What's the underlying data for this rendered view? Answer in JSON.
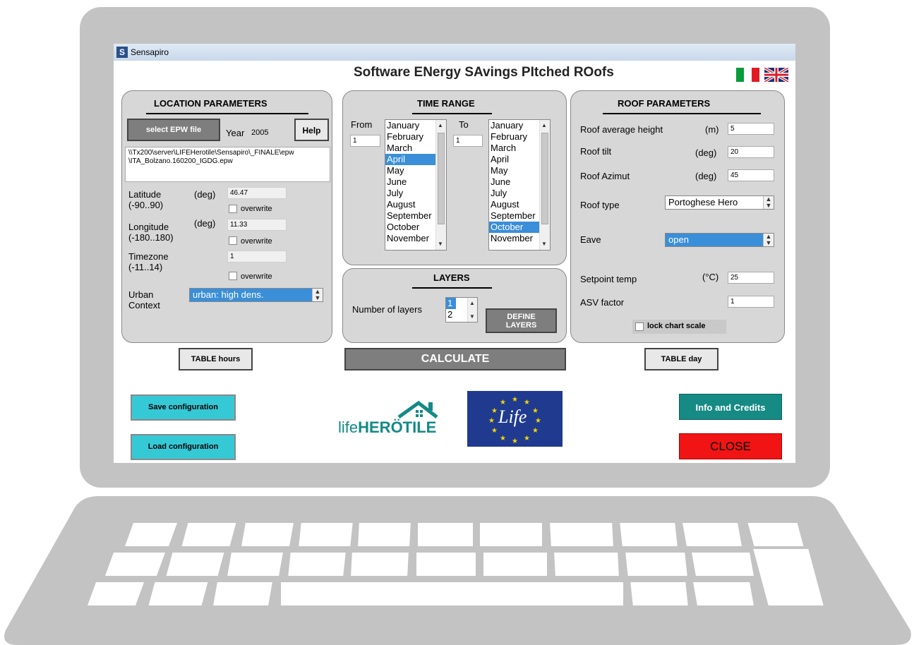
{
  "window": {
    "title": "Sensapiro",
    "icon_letter": "S"
  },
  "app_title": "Software ENergy SAvings PItched ROofs",
  "languages": [
    "italian-flag",
    "uk-flag"
  ],
  "location": {
    "title": "LOCATION PARAMETERS",
    "select_epw_label": "select EPW file",
    "year_label": "Year",
    "year_value": "2005",
    "help_label": "Help",
    "epw_path_line1": "\\\\Tx200\\server\\LIFEHerotile\\Sensapiro\\_FINALE\\epw",
    "epw_path_line2": "\\ITA_Bolzano.160200_IGDG.epw",
    "latitude_label": "Latitude",
    "latitude_range": "(-90..90)",
    "latitude_unit": "(deg)",
    "latitude_value": "46.47",
    "longitude_label": "Longitude",
    "longitude_range": "(-180..180)",
    "longitude_unit": "(deg)",
    "longitude_value": "11.33",
    "timezone_label": "Timezone",
    "timezone_range": "(-11..14)",
    "timezone_value": "1",
    "overwrite_label": "overwrite",
    "urban_label_1": "Urban",
    "urban_label_2": "Context",
    "urban_value": "urban: high dens."
  },
  "time_range": {
    "title": "TIME RANGE",
    "from_label": "From",
    "from_value": "1",
    "to_label": "To",
    "to_value": "1",
    "from_months": [
      "January",
      "February",
      "March",
      "April",
      "May",
      "June",
      "July",
      "August",
      "September",
      "October",
      "November"
    ],
    "from_selected": "April",
    "to_months": [
      "January",
      "February",
      "March",
      "April",
      "May",
      "June",
      "July",
      "August",
      "September",
      "October",
      "November"
    ],
    "to_selected": "October"
  },
  "layers": {
    "title": "LAYERS",
    "number_label": "Number of layers",
    "options": [
      "1",
      "2"
    ],
    "selected": "1",
    "define_line1": "DEFINE",
    "define_line2": "LAYERS"
  },
  "roof": {
    "title": "ROOF PARAMETERS",
    "avg_height_label": "Roof average height",
    "avg_height_unit": "(m)",
    "avg_height_value": "5",
    "tilt_label": "Roof tilt",
    "tilt_unit": "(deg)",
    "tilt_value": "20",
    "azimut_label": "Roof Azimut",
    "azimut_unit": "(deg)",
    "azimut_value": "45",
    "type_label": "Roof type",
    "type_value": "Portoghese  Hero",
    "eave_label": "Eave",
    "eave_value": "open",
    "setpoint_label": "Setpoint temp",
    "setpoint_unit": "(°C)",
    "setpoint_value": "25",
    "asv_label": "ASV factor",
    "asv_value": "1",
    "lock_label": "lock chart scale"
  },
  "buttons": {
    "table_hours": "TABLE hours",
    "calculate": "CALCULATE",
    "table_day": "TABLE day",
    "save_config": "Save configuration",
    "load_config": "Load configuration",
    "info_credits": "Info and Credits",
    "close": "CLOSE"
  },
  "logos": {
    "herotile_life": "life",
    "herotile_name": "HERÖTILE",
    "eu_life": "Life"
  },
  "colors": {
    "cyan_button": "#35c9d6",
    "info_button": "#168a84",
    "close_button": "#f01414",
    "selection": "#3b8ed8"
  }
}
